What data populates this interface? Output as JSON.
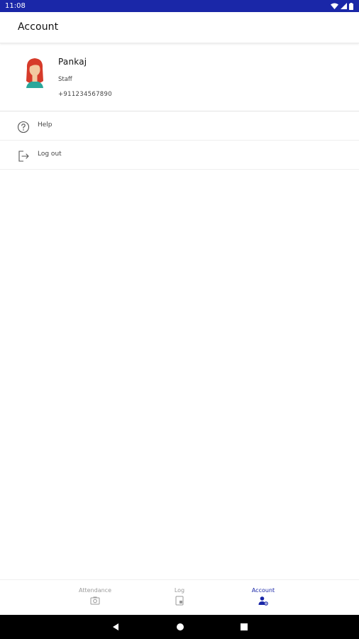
{
  "status_bar": {
    "time": "11:08",
    "icons": [
      "wifi-icon",
      "cellular-icon",
      "battery-icon"
    ]
  },
  "app_bar": {
    "title": "Account"
  },
  "profile": {
    "name": "Pankaj",
    "role": "Staff",
    "phone": "+911234567890",
    "avatar_icon": "female-avatar-icon"
  },
  "menu": {
    "help": {
      "label": "Help",
      "icon": "help-circle-icon"
    },
    "logout": {
      "label": "Log out",
      "icon": "logout-icon"
    }
  },
  "bottom_nav": {
    "items": [
      {
        "label": "Attendance",
        "icon": "camera-icon",
        "active": false
      },
      {
        "label": "Log",
        "icon": "log-icon",
        "active": false
      },
      {
        "label": "Account",
        "icon": "account-settings-icon",
        "active": true
      }
    ]
  },
  "system_nav": {
    "buttons": [
      "back-icon",
      "home-icon",
      "recents-icon"
    ]
  },
  "colors": {
    "primary": "#1a27a8",
    "inactive": "#9a9a9a",
    "avatar_hair": "#d63b2a",
    "avatar_skin": "#f2c9a0",
    "avatar_shirt": "#2aa79b"
  }
}
